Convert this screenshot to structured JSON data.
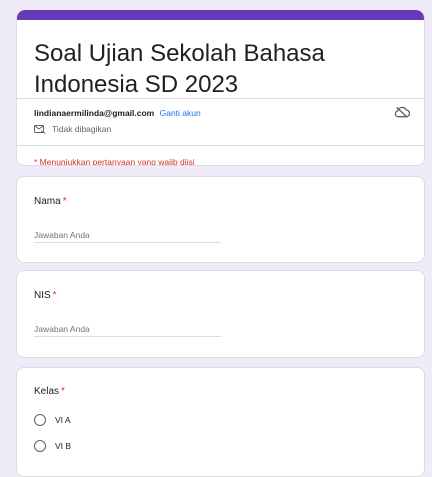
{
  "form": {
    "title": "Soal Ujian Sekolah Bahasa Indonesia SD 2023",
    "account_email": "lindianaermilinda@gmail.com",
    "switch_account": "Ganti akun",
    "not_shared": "Tidak dibagikan",
    "required_note": "* Menunjukkan pertanyaan yang wajib diisi"
  },
  "questions": [
    {
      "label": "Nama",
      "required": "*",
      "placeholder": "Jawaban Anda"
    },
    {
      "label": "NIS",
      "required": "*",
      "placeholder": "Jawaban Anda"
    },
    {
      "label": "Kelas",
      "required": "*",
      "options": [
        "VI A",
        "VI B"
      ]
    }
  ],
  "colors": {
    "accent": "#673ab7",
    "background": "#f0ebf8",
    "required": "#d93025",
    "link": "#1a73e8"
  }
}
